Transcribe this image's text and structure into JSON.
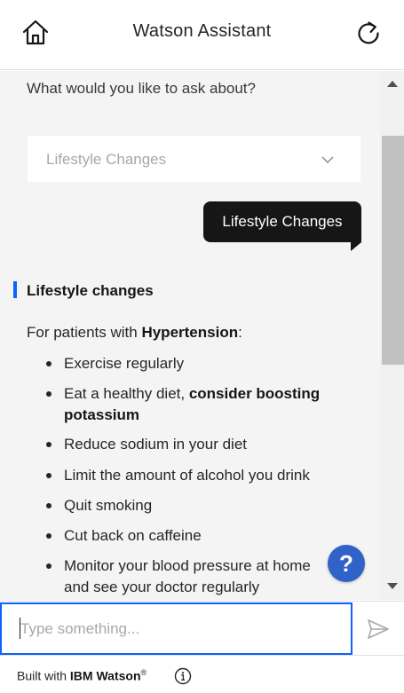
{
  "header": {
    "title": "Watson Assistant",
    "home_icon": "home-icon",
    "refresh_icon": "refresh-icon"
  },
  "chat": {
    "prompt": "What would you like to ask about?",
    "dropdown": {
      "selected": "Lifestyle Changes",
      "icon": "chevron-down-icon"
    },
    "user_message": "Lifestyle Changes",
    "section_title": "Lifestyle changes",
    "intro_prefix": "For patients with ",
    "intro_bold": "Hypertension",
    "intro_suffix": ":",
    "items": [
      {
        "line1": "Exercise regularly"
      },
      {
        "line1": "Eat a healthy diet, ",
        "line1_bold": "consider boosting",
        "line2_bold": "potassium"
      },
      {
        "line1": "Reduce sodium in your diet"
      },
      {
        "line1": "Limit the amount of alcohol you drink"
      },
      {
        "line1": "Quit smoking"
      },
      {
        "line1": "Cut back on caffeine"
      },
      {
        "line1": "Monitor your blood pressure at home",
        "line2": "and see your doctor regularly"
      }
    ]
  },
  "help_button": "?",
  "input": {
    "placeholder": "Type something...",
    "send_icon": "send-icon"
  },
  "footer": {
    "built_with": "Built with ",
    "brand": "IBM Watson",
    "trademark": "®",
    "info_icon": "info-icon"
  },
  "colors": {
    "accent": "#0f62fe",
    "help_button": "#3162c8",
    "chat_background": "#f4f4f4",
    "user_bubble": "#161616"
  }
}
